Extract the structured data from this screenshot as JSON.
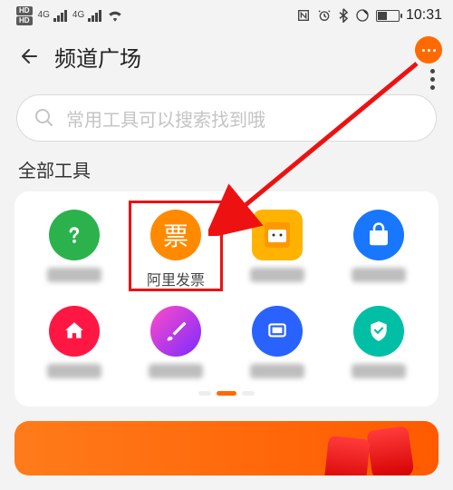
{
  "status": {
    "hd1": "HD ᵃ",
    "hd2": "HD ᵇ",
    "sig_label": "4G",
    "time": "10:31"
  },
  "header": {
    "title": "频道广场"
  },
  "search": {
    "placeholder": "常用工具可以搜索找到哦"
  },
  "section_title": "全部工具",
  "tools": {
    "row1": [
      {
        "label_visible": false
      },
      {
        "label": "阿里发票",
        "icon_text": "票",
        "label_visible": true,
        "highlighted": true
      },
      {
        "label_visible": false
      },
      {
        "label_visible": false
      }
    ],
    "row2": [
      {
        "label_visible": false
      },
      {
        "label_visible": false
      },
      {
        "label_visible": false
      },
      {
        "label_visible": false
      }
    ]
  }
}
